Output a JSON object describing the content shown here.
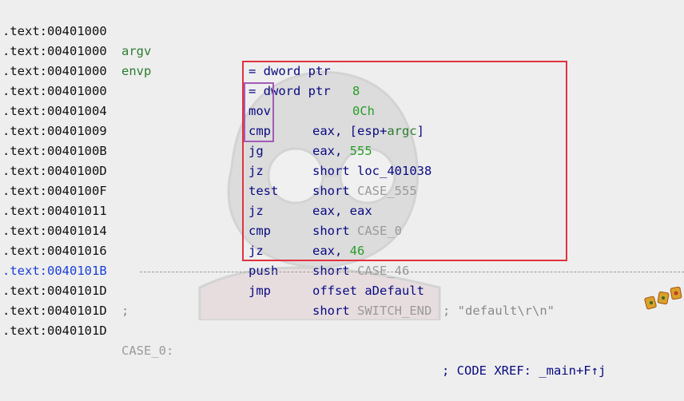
{
  "colors": {
    "background": "#eeeeee",
    "address": "#111111",
    "current_address": "#1a3fd8",
    "mnemonic": "#0a0a82",
    "symbol": "#2e7d32",
    "number": "#2a9d2a",
    "dim_label": "#9a9a9a",
    "highlight_box": "#e0323f",
    "jump_box": "#a35bb8"
  },
  "lines": [
    {
      "addr": ".text:00401000",
      "name": "argv",
      "eq": "= dword ptr",
      "val": "8"
    },
    {
      "addr": ".text:00401000",
      "name": "envp",
      "eq": "= dword ptr",
      "val": "0Ch"
    },
    {
      "addr": ".text:00401000"
    },
    {
      "addr": ".text:00401000",
      "mn": "mov",
      "op1": "eax, [esp+",
      "op1_sym": "argc",
      "op1_end": "]"
    },
    {
      "addr": ".text:00401004",
      "mn": "cmp",
      "op1": "eax, ",
      "op1_num": "555"
    },
    {
      "addr": ".text:00401009",
      "mn": "jg",
      "op1": "short loc_401038"
    },
    {
      "addr": ".text:0040100B",
      "mn": "jz",
      "op1": "short ",
      "op1_lbl": "CASE_555"
    },
    {
      "addr": ".text:0040100D",
      "mn": "test",
      "op1": "eax, eax"
    },
    {
      "addr": ".text:0040100F",
      "mn": "jz",
      "op1": "short ",
      "op1_lbl": "CASE_0"
    },
    {
      "addr": ".text:00401011",
      "mn": "cmp",
      "op1": "eax, ",
      "op1_num": "46"
    },
    {
      "addr": ".text:00401014",
      "mn": "jz",
      "op1": "short ",
      "op1_lbl": "CASE_46"
    },
    {
      "addr": ".text:00401016",
      "mn": "push",
      "op1": "offset aDefault",
      "comment": "; \"default\\r\\n\""
    },
    {
      "addr": ".text:0040101B",
      "mn": "jmp",
      "op1": "short ",
      "op1_lbl": "SWITCH_END"
    },
    {
      "addr": ".text:0040101D",
      "comment": ";"
    },
    {
      "addr": ".text:0040101D"
    },
    {
      "addr": ".text:0040101D",
      "label": "CASE_0:",
      "xref": "; CODE XREF: _main+F↑j"
    }
  ]
}
